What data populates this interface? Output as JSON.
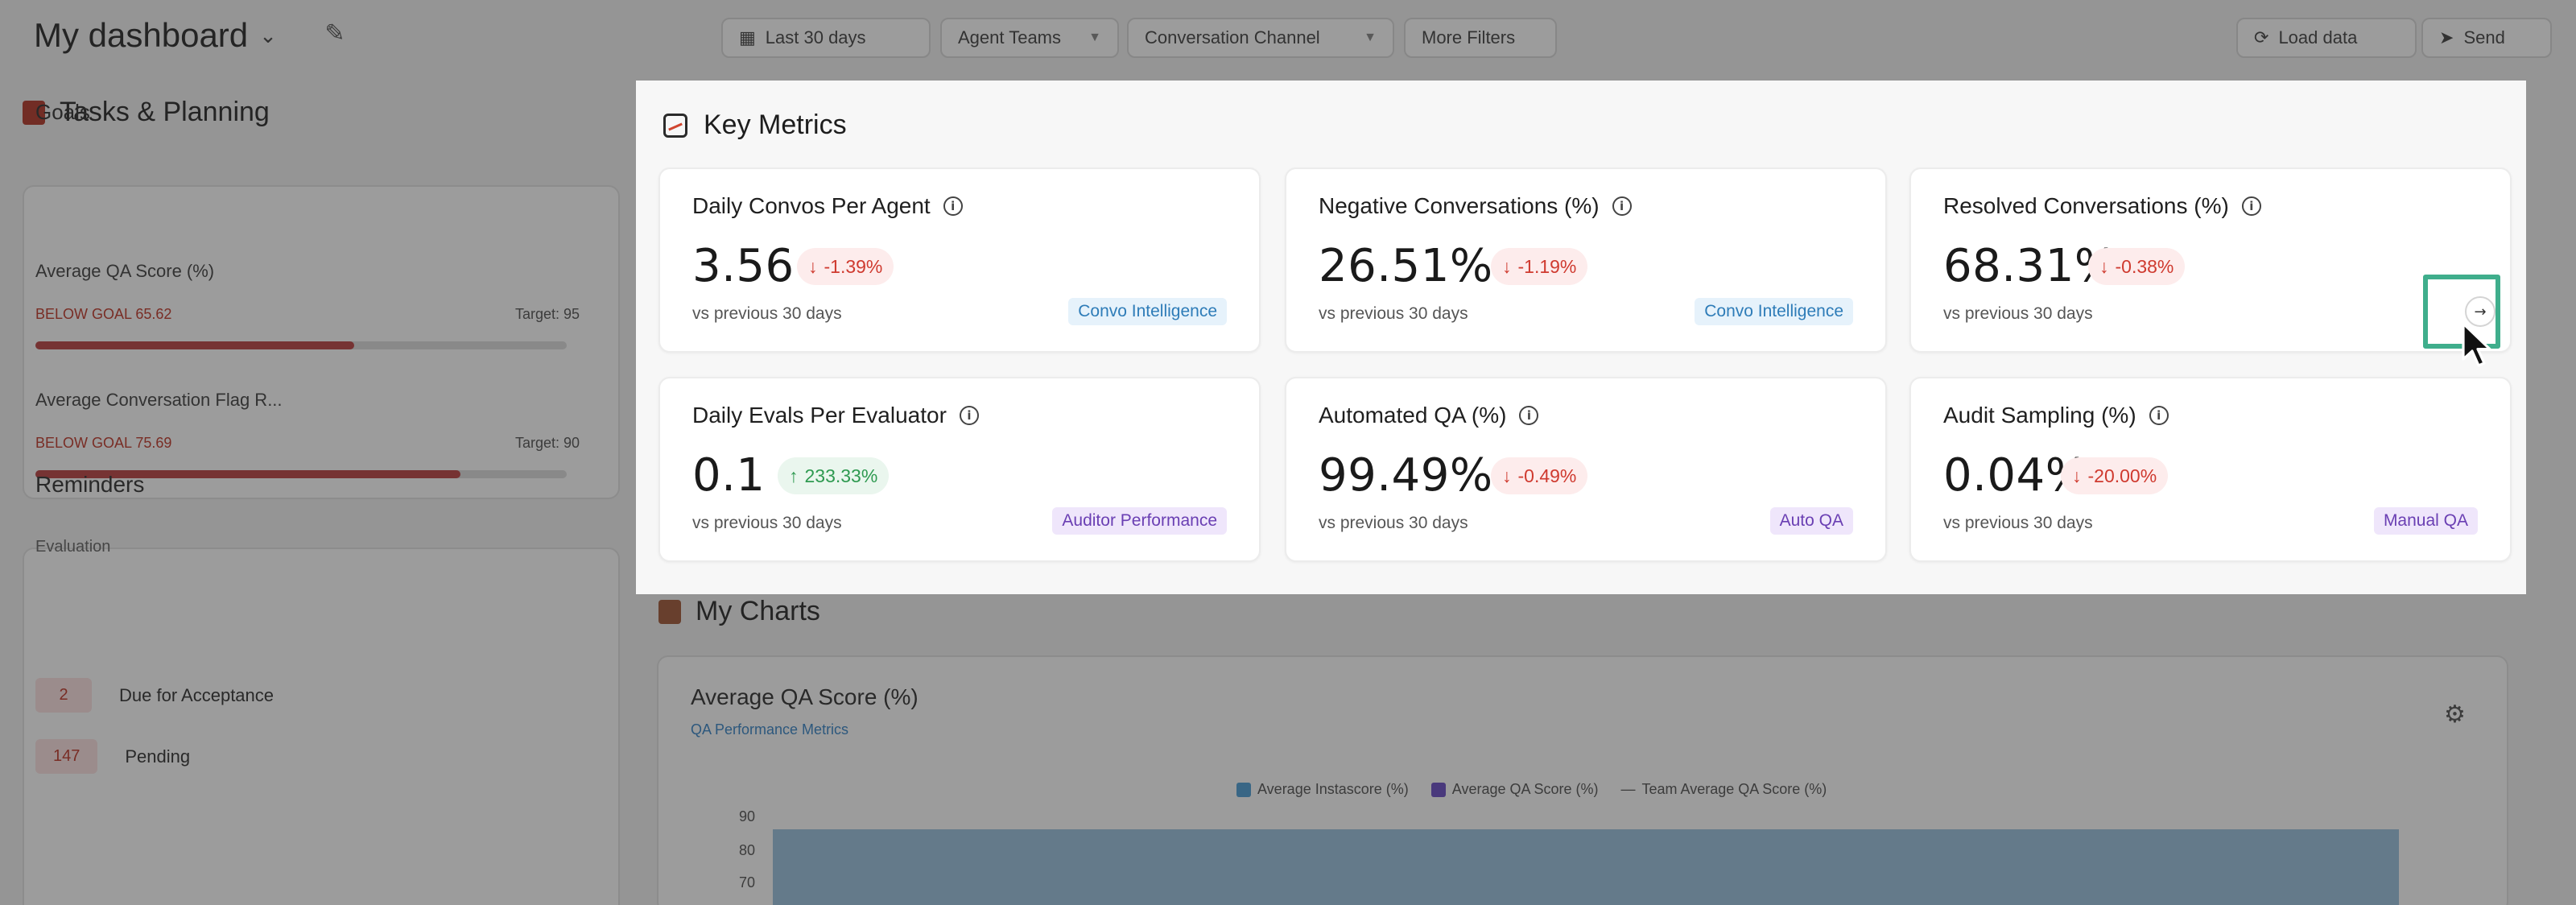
{
  "header": {
    "title": "My dashboard",
    "filters": [
      {
        "label": "Last 30 days",
        "icon": "calendar-icon"
      },
      {
        "label": "Agent Teams"
      },
      {
        "label": "Conversation Channel"
      },
      {
        "label": "More Filters"
      }
    ],
    "load_label": "Load data",
    "send_label": "Send"
  },
  "left": {
    "tasks_title": "Tasks & Planning",
    "goals": {
      "title": "Goals",
      "items": [
        {
          "name": "Average QA Score (%)",
          "status": "BELOW GOAL 65.62",
          "target": "Target: 95",
          "progress": 0.6
        },
        {
          "name": "Average Conversation Flag R...",
          "status": "BELOW GOAL 75.69",
          "target": "Target: 90",
          "progress": 0.8
        }
      ]
    },
    "reminders": {
      "title": "Reminders",
      "subtitle": "Evaluation",
      "items": [
        {
          "count": "2",
          "label": "Due for Acceptance"
        },
        {
          "count": "147",
          "label": "Pending"
        }
      ]
    }
  },
  "charts": {
    "section_title": "My Charts",
    "card": {
      "title": "Average QA Score (%)",
      "subtitle": "QA Performance Metrics",
      "legend": [
        "Average Instascore (%)",
        "Average QA Score (%)",
        "Team Average QA Score (%)"
      ],
      "y_ticks": [
        "90",
        "80",
        "70"
      ]
    }
  },
  "key_metrics": {
    "title": "Key Metrics",
    "cards": [
      {
        "title": "Daily Convos Per Agent",
        "value": "3.56",
        "delta": "-1.39%",
        "direction": "down",
        "comparison": "vs previous 30 days",
        "tag": "Convo Intelligence",
        "tag_color": "blue"
      },
      {
        "title": "Negative Conversations (%)",
        "value": "26.51%",
        "delta": "-1.19%",
        "direction": "down",
        "comparison": "vs previous 30 days",
        "tag": "Convo Intelligence",
        "tag_color": "blue"
      },
      {
        "title": "Resolved Conversations (%)",
        "value": "68.31%",
        "delta": "-0.38%",
        "direction": "down",
        "comparison": "vs previous 30 days",
        "tag": "",
        "tag_color": ""
      },
      {
        "title": "Daily Evals Per Evaluator",
        "value": "0.1",
        "delta": "233.33%",
        "direction": "up",
        "comparison": "vs previous 30 days",
        "tag": "Auditor Performance",
        "tag_color": "purple"
      },
      {
        "title": "Automated QA (%)",
        "value": "99.49%",
        "delta": "-0.49%",
        "direction": "down",
        "comparison": "vs previous 30 days",
        "tag": "Auto QA",
        "tag_color": "purple"
      },
      {
        "title": "Audit Sampling (%)",
        "value": "0.04%",
        "delta": "-20.00%",
        "direction": "down",
        "comparison": "vs previous 30 days",
        "tag": "Manual QA",
        "tag_color": "purple"
      }
    ]
  },
  "colors": {
    "down": "#cf3a2f",
    "up": "#2f9a51",
    "highlight": "#3fae8c",
    "brand": "#b53a2b"
  }
}
